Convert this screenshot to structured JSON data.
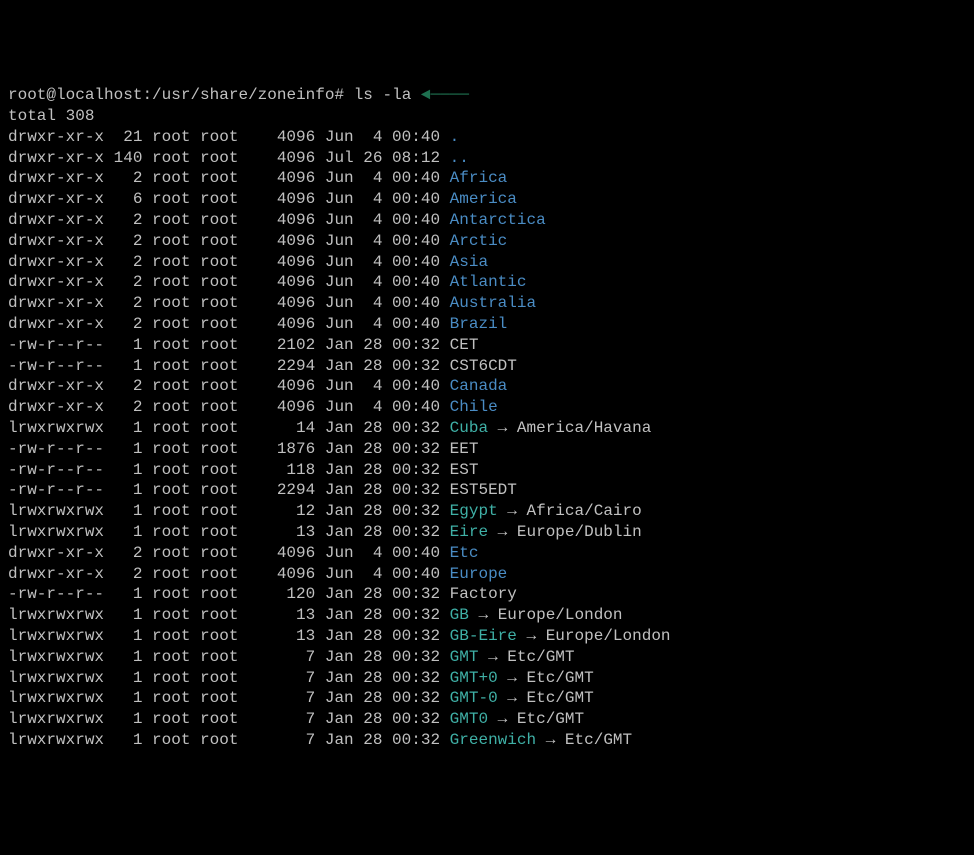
{
  "prompt": {
    "user": "root",
    "host": "localhost",
    "path": "/usr/share/zoneinfo",
    "symbol": "#",
    "command": "ls -la"
  },
  "annotation": {
    "arrow": "◄────"
  },
  "total": {
    "label": "total",
    "value": "308"
  },
  "rows": [
    {
      "perms": "drwxr-xr-x",
      "links": "21",
      "owner": "root",
      "group": "root",
      "size": "4096",
      "date": "Jun  4 00:40",
      "name": ".",
      "type": "dir"
    },
    {
      "perms": "drwxr-xr-x",
      "links": "140",
      "owner": "root",
      "group": "root",
      "size": "4096",
      "date": "Jul 26 08:12",
      "name": "..",
      "type": "dir"
    },
    {
      "perms": "drwxr-xr-x",
      "links": "2",
      "owner": "root",
      "group": "root",
      "size": "4096",
      "date": "Jun  4 00:40",
      "name": "Africa",
      "type": "dir"
    },
    {
      "perms": "drwxr-xr-x",
      "links": "6",
      "owner": "root",
      "group": "root",
      "size": "4096",
      "date": "Jun  4 00:40",
      "name": "America",
      "type": "dir"
    },
    {
      "perms": "drwxr-xr-x",
      "links": "2",
      "owner": "root",
      "group": "root",
      "size": "4096",
      "date": "Jun  4 00:40",
      "name": "Antarctica",
      "type": "dir"
    },
    {
      "perms": "drwxr-xr-x",
      "links": "2",
      "owner": "root",
      "group": "root",
      "size": "4096",
      "date": "Jun  4 00:40",
      "name": "Arctic",
      "type": "dir"
    },
    {
      "perms": "drwxr-xr-x",
      "links": "2",
      "owner": "root",
      "group": "root",
      "size": "4096",
      "date": "Jun  4 00:40",
      "name": "Asia",
      "type": "dir"
    },
    {
      "perms": "drwxr-xr-x",
      "links": "2",
      "owner": "root",
      "group": "root",
      "size": "4096",
      "date": "Jun  4 00:40",
      "name": "Atlantic",
      "type": "dir"
    },
    {
      "perms": "drwxr-xr-x",
      "links": "2",
      "owner": "root",
      "group": "root",
      "size": "4096",
      "date": "Jun  4 00:40",
      "name": "Australia",
      "type": "dir"
    },
    {
      "perms": "drwxr-xr-x",
      "links": "2",
      "owner": "root",
      "group": "root",
      "size": "4096",
      "date": "Jun  4 00:40",
      "name": "Brazil",
      "type": "dir"
    },
    {
      "perms": "-rw-r--r--",
      "links": "1",
      "owner": "root",
      "group": "root",
      "size": "2102",
      "date": "Jan 28 00:32",
      "name": "CET",
      "type": "file"
    },
    {
      "perms": "-rw-r--r--",
      "links": "1",
      "owner": "root",
      "group": "root",
      "size": "2294",
      "date": "Jan 28 00:32",
      "name": "CST6CDT",
      "type": "file"
    },
    {
      "perms": "drwxr-xr-x",
      "links": "2",
      "owner": "root",
      "group": "root",
      "size": "4096",
      "date": "Jun  4 00:40",
      "name": "Canada",
      "type": "dir"
    },
    {
      "perms": "drwxr-xr-x",
      "links": "2",
      "owner": "root",
      "group": "root",
      "size": "4096",
      "date": "Jun  4 00:40",
      "name": "Chile",
      "type": "dir"
    },
    {
      "perms": "lrwxrwxrwx",
      "links": "1",
      "owner": "root",
      "group": "root",
      "size": "14",
      "date": "Jan 28 00:32",
      "name": "Cuba",
      "type": "symlink",
      "target": "America/Havana"
    },
    {
      "perms": "-rw-r--r--",
      "links": "1",
      "owner": "root",
      "group": "root",
      "size": "1876",
      "date": "Jan 28 00:32",
      "name": "EET",
      "type": "file"
    },
    {
      "perms": "-rw-r--r--",
      "links": "1",
      "owner": "root",
      "group": "root",
      "size": "118",
      "date": "Jan 28 00:32",
      "name": "EST",
      "type": "file"
    },
    {
      "perms": "-rw-r--r--",
      "links": "1",
      "owner": "root",
      "group": "root",
      "size": "2294",
      "date": "Jan 28 00:32",
      "name": "EST5EDT",
      "type": "file"
    },
    {
      "perms": "lrwxrwxrwx",
      "links": "1",
      "owner": "root",
      "group": "root",
      "size": "12",
      "date": "Jan 28 00:32",
      "name": "Egypt",
      "type": "symlink",
      "target": "Africa/Cairo"
    },
    {
      "perms": "lrwxrwxrwx",
      "links": "1",
      "owner": "root",
      "group": "root",
      "size": "13",
      "date": "Jan 28 00:32",
      "name": "Eire",
      "type": "symlink",
      "target": "Europe/Dublin"
    },
    {
      "perms": "drwxr-xr-x",
      "links": "2",
      "owner": "root",
      "group": "root",
      "size": "4096",
      "date": "Jun  4 00:40",
      "name": "Etc",
      "type": "dir"
    },
    {
      "perms": "drwxr-xr-x",
      "links": "2",
      "owner": "root",
      "group": "root",
      "size": "4096",
      "date": "Jun  4 00:40",
      "name": "Europe",
      "type": "dir"
    },
    {
      "perms": "-rw-r--r--",
      "links": "1",
      "owner": "root",
      "group": "root",
      "size": "120",
      "date": "Jan 28 00:32",
      "name": "Factory",
      "type": "file"
    },
    {
      "perms": "lrwxrwxrwx",
      "links": "1",
      "owner": "root",
      "group": "root",
      "size": "13",
      "date": "Jan 28 00:32",
      "name": "GB",
      "type": "symlink",
      "target": "Europe/London"
    },
    {
      "perms": "lrwxrwxrwx",
      "links": "1",
      "owner": "root",
      "group": "root",
      "size": "13",
      "date": "Jan 28 00:32",
      "name": "GB-Eire",
      "type": "symlink",
      "target": "Europe/London"
    },
    {
      "perms": "lrwxrwxrwx",
      "links": "1",
      "owner": "root",
      "group": "root",
      "size": "7",
      "date": "Jan 28 00:32",
      "name": "GMT",
      "type": "symlink",
      "target": "Etc/GMT"
    },
    {
      "perms": "lrwxrwxrwx",
      "links": "1",
      "owner": "root",
      "group": "root",
      "size": "7",
      "date": "Jan 28 00:32",
      "name": "GMT+0",
      "type": "symlink",
      "target": "Etc/GMT"
    },
    {
      "perms": "lrwxrwxrwx",
      "links": "1",
      "owner": "root",
      "group": "root",
      "size": "7",
      "date": "Jan 28 00:32",
      "name": "GMT-0",
      "type": "symlink",
      "target": "Etc/GMT"
    },
    {
      "perms": "lrwxrwxrwx",
      "links": "1",
      "owner": "root",
      "group": "root",
      "size": "7",
      "date": "Jan 28 00:32",
      "name": "GMT0",
      "type": "symlink",
      "target": "Etc/GMT"
    },
    {
      "perms": "lrwxrwxrwx",
      "links": "1",
      "owner": "root",
      "group": "root",
      "size": "7",
      "date": "Jan 28 00:32",
      "name": "Greenwich",
      "type": "symlink",
      "target": "Etc/GMT"
    }
  ]
}
